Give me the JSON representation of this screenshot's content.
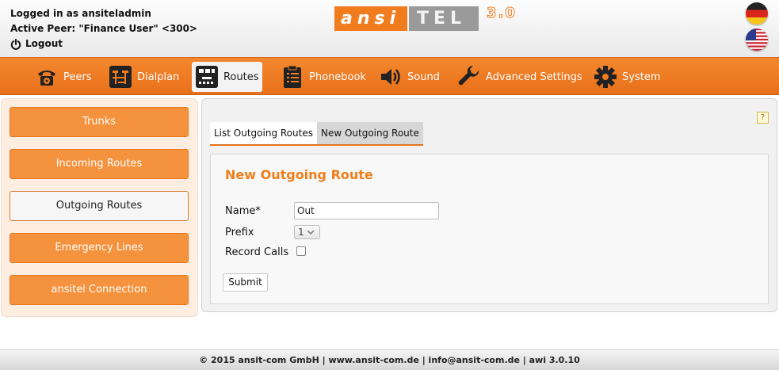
{
  "header": {
    "logged_in_text": "Logged in as ansiteladmin",
    "active_peer_text": "Active Peer: \"Finance User\" <300>",
    "logout_label": "Logout",
    "logo": {
      "part1": "ansi",
      "part2": "TEL",
      "version": "3.0"
    },
    "flags": [
      {
        "name": "german-flag-icon"
      },
      {
        "name": "us-flag-icon"
      }
    ]
  },
  "nav": {
    "items": [
      {
        "label": "Peers",
        "icon": "phone-icon"
      },
      {
        "label": "Dialplan",
        "icon": "dialplan-icon"
      },
      {
        "label": "Routes",
        "icon": "routes-icon",
        "active": true
      },
      {
        "label": "Phonebook",
        "icon": "clipboard-icon"
      },
      {
        "label": "Sound",
        "icon": "speaker-icon"
      },
      {
        "label": "Advanced Settings",
        "icon": "wrench-icon"
      },
      {
        "label": "System",
        "icon": "gear-icon"
      }
    ]
  },
  "sidebar": {
    "items": [
      {
        "label": "Trunks"
      },
      {
        "label": "Incoming Routes"
      },
      {
        "label": "Outgoing Routes",
        "active": true
      },
      {
        "label": "Emergency Lines"
      },
      {
        "label": "ansitel Connection"
      }
    ]
  },
  "main": {
    "help_label": "?",
    "tabs": [
      {
        "label": "List Outgoing Routes"
      },
      {
        "label": "New Outgoing Route",
        "active": true
      }
    ],
    "form": {
      "title": "New Outgoing Route",
      "name_label": "Name*",
      "name_value": "Out",
      "prefix_label": "Prefix",
      "prefix_value": "1",
      "record_label": "Record Calls",
      "record_checked": false,
      "submit_label": "Submit"
    }
  },
  "footer": {
    "text": "© 2015 ansit-com GmbH | www.ansit-com.de | info@ansit-com.de | awi 3.0.10"
  },
  "colors": {
    "accent": "#f07c1e",
    "sidebar_bg": "#fdeee1",
    "panel_bg": "#f1f1f1"
  }
}
